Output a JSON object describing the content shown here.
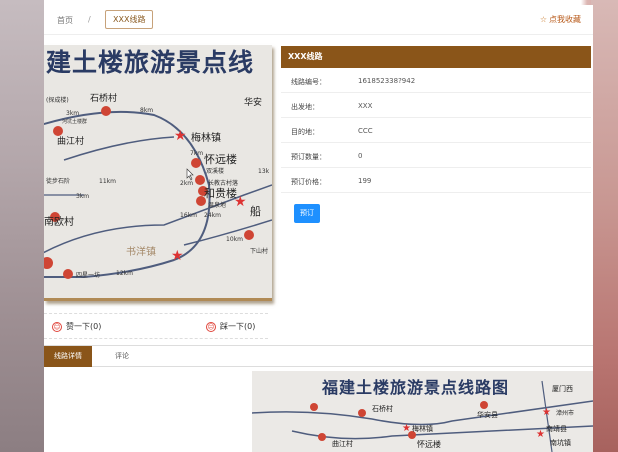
{
  "breadcrumb": {
    "home": "首页",
    "separator": "/",
    "current": "XXX线路"
  },
  "favorite": {
    "label": "点我收藏",
    "icon": "star-outline"
  },
  "map": {
    "title": "建土楼旅游景点线",
    "places": [
      "(探成楼)",
      "石桥村",
      "河坑土楼群",
      "曲江村",
      "梅林镇",
      "怀远楼",
      "双溪楼",
      "长教古村落",
      "和贵楼",
      "温泉地",
      "船",
      "华安",
      "徒步石阶",
      "南欧村",
      "书洋镇",
      "下山村",
      "四星一坊"
    ],
    "distances": [
      "3km",
      "8km",
      "7km",
      "2km",
      "11km",
      "3km",
      "24km",
      "16km",
      "12km",
      "10km",
      "13k"
    ]
  },
  "votes": {
    "up": "赞一下(0)",
    "down": "踩一下(0)"
  },
  "info": {
    "title": "XXX线路",
    "rows": [
      {
        "label": "线路编号：",
        "value": "161852338?942"
      },
      {
        "label": "出发地：",
        "value": "XXX"
      },
      {
        "label": "目的地：",
        "value": "CCC"
      },
      {
        "label": "预订数量：",
        "value": "0"
      },
      {
        "label": "预订价格：",
        "value": "199"
      }
    ],
    "book_button": "预订"
  },
  "tabs": [
    {
      "label": "线路详情",
      "active": true
    },
    {
      "label": "评论",
      "active": false
    }
  ],
  "bottom_map": {
    "title": "福建土楼旅游景点线路图",
    "places": [
      "厦门西",
      "华安县",
      "漳州市",
      "石桥村",
      "南靖县",
      "梅林镇",
      "南坑镇",
      "怀远楼",
      "曲江村"
    ]
  },
  "colors": {
    "brand": "#8a5519",
    "accent_blue": "#1e90ff",
    "favorite": "#b85a1a"
  }
}
